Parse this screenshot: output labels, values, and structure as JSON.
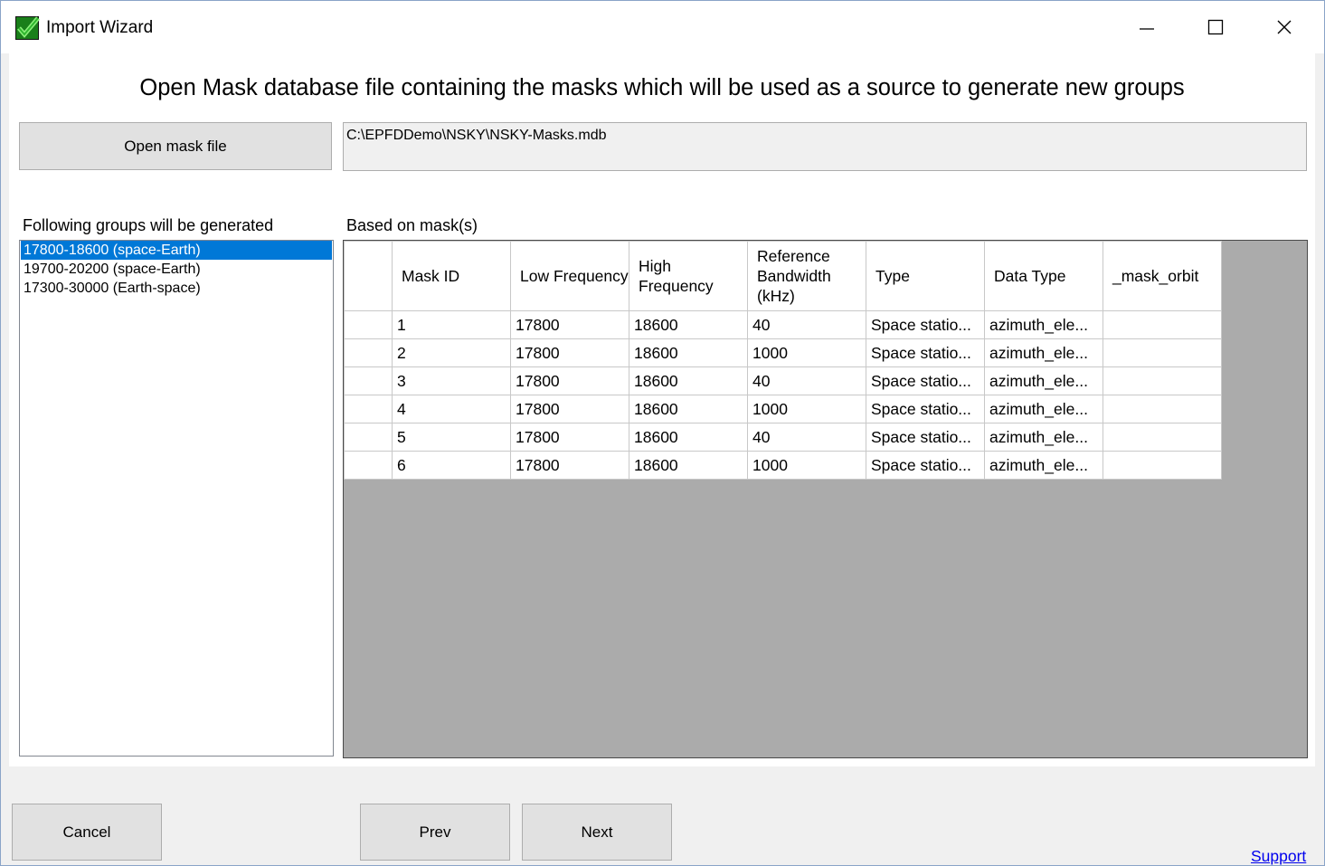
{
  "window": {
    "title": "Import Wizard",
    "controls": {
      "minimize": "—",
      "maximize": "☐",
      "close": "✕"
    }
  },
  "heading": "Open Mask database file containing the masks which will be used as a source to generate new groups",
  "open_button": "Open mask file",
  "file_path": "C:\\EPFDDemo\\NSKY\\NSKY-Masks.mdb",
  "groups": {
    "label": "Following groups will be generated",
    "items": [
      "17800-18600 (space-Earth)",
      "19700-20200 (space-Earth)",
      "17300-30000 (Earth-space)"
    ]
  },
  "masks": {
    "label": "Based on mask(s)",
    "columns": [
      "Mask ID",
      "Low Frequency",
      "High Frequency",
      "Reference Bandwidth (kHz)",
      "Type",
      "Data Type",
      "_mask_orbit"
    ],
    "rows": [
      [
        "1",
        "17800",
        "18600",
        "40",
        "Space statio...",
        "azimuth_ele...",
        ""
      ],
      [
        "2",
        "17800",
        "18600",
        "1000",
        "Space statio...",
        "azimuth_ele...",
        ""
      ],
      [
        "3",
        "17800",
        "18600",
        "40",
        "Space statio...",
        "azimuth_ele...",
        ""
      ],
      [
        "4",
        "17800",
        "18600",
        "1000",
        "Space statio...",
        "azimuth_ele...",
        ""
      ],
      [
        "5",
        "17800",
        "18600",
        "40",
        "Space statio...",
        "azimuth_ele...",
        ""
      ],
      [
        "6",
        "17800",
        "18600",
        "1000",
        "Space statio...",
        "azimuth_ele...",
        ""
      ]
    ]
  },
  "footer": {
    "cancel": "Cancel",
    "prev": "Prev",
    "next": "Next",
    "support": "Support"
  },
  "colors": {
    "selection": "#0078d7",
    "grid_background": "#ababab",
    "link": "#0000ee"
  }
}
